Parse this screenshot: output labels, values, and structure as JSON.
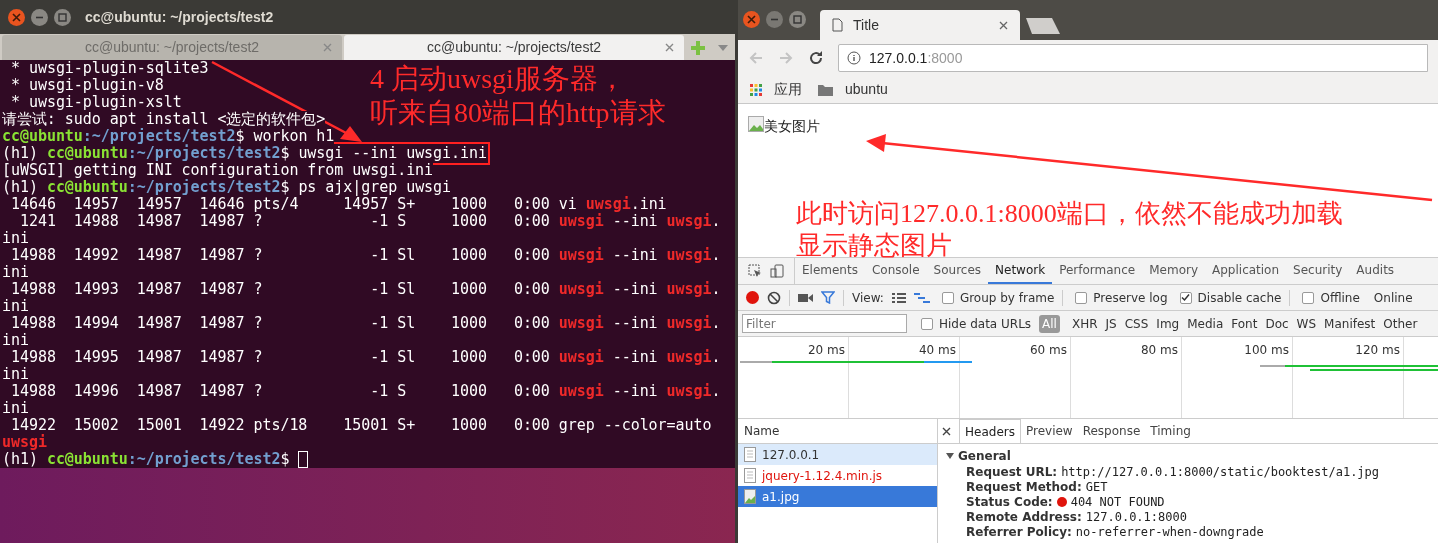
{
  "terminal": {
    "title": "cc@ubuntu: ~/projects/test2",
    "tabs": [
      {
        "label": "cc@ubuntu: ~/projects/test2",
        "selected": false
      },
      {
        "label": "cc@ubuntu: ~/projects/test2",
        "selected": true
      }
    ],
    "lines": [
      {
        "segments": [
          {
            "kind": "plain",
            "text": " * uwsgi-plugin-sqlite3"
          }
        ]
      },
      {
        "segments": [
          {
            "kind": "plain",
            "text": " * uwsgi-plugin-v8"
          }
        ]
      },
      {
        "segments": [
          {
            "kind": "plain",
            "text": " * uwsgi-plugin-xslt"
          }
        ]
      },
      {
        "segments": [
          {
            "kind": "plain",
            "text": "请尝试: sudo apt install <选定的软件包>"
          }
        ]
      },
      {
        "segments": [
          {
            "kind": "user",
            "text": "cc@ubuntu"
          },
          {
            "kind": "path",
            "text": ":~/projects/test2"
          },
          {
            "kind": "plain",
            "text": "$ workon h1"
          }
        ]
      },
      {
        "segments": [
          {
            "kind": "plain",
            "text": "(h1) "
          },
          {
            "kind": "user",
            "text": "cc@ubuntu"
          },
          {
            "kind": "path",
            "text": ":~/projects/test2"
          },
          {
            "kind": "plain",
            "text": "$ "
          },
          {
            "kind": "boxed",
            "text": "uwsgi --ini uwsgi.ini"
          }
        ]
      },
      {
        "segments": [
          {
            "kind": "plain",
            "text": "[uWSGI] getting INI configuration from uwsgi.ini"
          }
        ]
      },
      {
        "segments": [
          {
            "kind": "plain",
            "text": "(h1) "
          },
          {
            "kind": "user",
            "text": "cc@ubuntu"
          },
          {
            "kind": "path",
            "text": ":~/projects/test2"
          },
          {
            "kind": "plain",
            "text": "$ ps ajx|grep uwsgi"
          }
        ]
      },
      {
        "segments": [
          {
            "kind": "plain",
            "text": " 14646  14957  14957  14646 pts/4     14957 S+    1000   0:00 vi "
          },
          {
            "kind": "match",
            "text": "uwsgi"
          },
          {
            "kind": "plain",
            "text": ".ini"
          }
        ]
      },
      {
        "segments": [
          {
            "kind": "plain",
            "text": "  1241  14988  14987  14987 ?            -1 S     1000   0:00 "
          },
          {
            "kind": "match",
            "text": "uwsgi"
          },
          {
            "kind": "plain",
            "text": " --ini "
          },
          {
            "kind": "match",
            "text": "uwsgi"
          },
          {
            "kind": "plain",
            "text": "."
          }
        ]
      },
      {
        "segments": [
          {
            "kind": "plain",
            "text": "ini"
          }
        ]
      },
      {
        "segments": [
          {
            "kind": "plain",
            "text": " 14988  14992  14987  14987 ?            -1 Sl    1000   0:00 "
          },
          {
            "kind": "match",
            "text": "uwsgi"
          },
          {
            "kind": "plain",
            "text": " --ini "
          },
          {
            "kind": "match",
            "text": "uwsgi"
          },
          {
            "kind": "plain",
            "text": "."
          }
        ]
      },
      {
        "segments": [
          {
            "kind": "plain",
            "text": "ini"
          }
        ]
      },
      {
        "segments": [
          {
            "kind": "plain",
            "text": " 14988  14993  14987  14987 ?            -1 Sl    1000   0:00 "
          },
          {
            "kind": "match",
            "text": "uwsgi"
          },
          {
            "kind": "plain",
            "text": " --ini "
          },
          {
            "kind": "match",
            "text": "uwsgi"
          },
          {
            "kind": "plain",
            "text": "."
          }
        ]
      },
      {
        "segments": [
          {
            "kind": "plain",
            "text": "ini"
          }
        ]
      },
      {
        "segments": [
          {
            "kind": "plain",
            "text": " 14988  14994  14987  14987 ?            -1 Sl    1000   0:00 "
          },
          {
            "kind": "match",
            "text": "uwsgi"
          },
          {
            "kind": "plain",
            "text": " --ini "
          },
          {
            "kind": "match",
            "text": "uwsgi"
          },
          {
            "kind": "plain",
            "text": "."
          }
        ]
      },
      {
        "segments": [
          {
            "kind": "plain",
            "text": "ini"
          }
        ]
      },
      {
        "segments": [
          {
            "kind": "plain",
            "text": " 14988  14995  14987  14987 ?            -1 Sl    1000   0:00 "
          },
          {
            "kind": "match",
            "text": "uwsgi"
          },
          {
            "kind": "plain",
            "text": " --ini "
          },
          {
            "kind": "match",
            "text": "uwsgi"
          },
          {
            "kind": "plain",
            "text": "."
          }
        ]
      },
      {
        "segments": [
          {
            "kind": "plain",
            "text": "ini"
          }
        ]
      },
      {
        "segments": [
          {
            "kind": "plain",
            "text": " 14988  14996  14987  14987 ?            -1 S     1000   0:00 "
          },
          {
            "kind": "match",
            "text": "uwsgi"
          },
          {
            "kind": "plain",
            "text": " --ini "
          },
          {
            "kind": "match",
            "text": "uwsgi"
          },
          {
            "kind": "plain",
            "text": "."
          }
        ]
      },
      {
        "segments": [
          {
            "kind": "plain",
            "text": "ini"
          }
        ]
      },
      {
        "segments": [
          {
            "kind": "plain",
            "text": " 14922  15002  15001  14922 pts/18    15001 S+    1000   0:00 grep --color=auto"
          }
        ]
      },
      {
        "segments": [
          {
            "kind": "match",
            "text": "uwsgi"
          }
        ]
      },
      {
        "segments": [
          {
            "kind": "plain",
            "text": "(h1) "
          },
          {
            "kind": "user",
            "text": "cc@ubuntu"
          },
          {
            "kind": "path",
            "text": ":~/projects/test2"
          },
          {
            "kind": "plain",
            "text": "$ "
          }
        ],
        "cursor": true
      }
    ]
  },
  "browser": {
    "tab_title": "Title",
    "url_host": "127.0.0.1",
    "url_port": ":8000",
    "bookmarks": [
      {
        "kind": "apps",
        "label": "应用"
      },
      {
        "kind": "folder",
        "label": "ubuntu"
      }
    ],
    "page": {
      "image_alt": "美女图片"
    },
    "devtools": {
      "tabs": [
        {
          "label": "Elements",
          "selected": false
        },
        {
          "label": "Console",
          "selected": false
        },
        {
          "label": "Sources",
          "selected": false
        },
        {
          "label": "Network",
          "selected": true
        },
        {
          "label": "Performance",
          "selected": false
        },
        {
          "label": "Memory",
          "selected": false
        },
        {
          "label": "Application",
          "selected": false
        },
        {
          "label": "Security",
          "selected": false
        },
        {
          "label": "Audits",
          "selected": false
        }
      ],
      "recording": true,
      "view_label": "View:",
      "options": [
        {
          "label": "Group by frame",
          "checked": false
        },
        {
          "label": "Preserve log",
          "checked": false
        },
        {
          "label": "Disable cache",
          "checked": true
        },
        {
          "label": "Offline",
          "checked": false
        }
      ],
      "throttle": "Online",
      "filter": {
        "placeholder": "Filter"
      },
      "hide_data_urls": {
        "label": "Hide data URLs",
        "checked": false
      },
      "types": [
        {
          "label": "All",
          "selected": true
        },
        {
          "label": "XHR",
          "selected": false
        },
        {
          "label": "JS",
          "selected": false
        },
        {
          "label": "CSS",
          "selected": false
        },
        {
          "label": "Img",
          "selected": false
        },
        {
          "label": "Media",
          "selected": false
        },
        {
          "label": "Font",
          "selected": false
        },
        {
          "label": "Doc",
          "selected": false
        },
        {
          "label": "WS",
          "selected": false
        },
        {
          "label": "Manifest",
          "selected": false
        },
        {
          "label": "Other",
          "selected": false
        }
      ],
      "timeline_ticks": [
        "20 ms",
        "40 ms",
        "60 ms",
        "80 ms",
        "100 ms",
        "120 ms"
      ],
      "list_header": "Name",
      "requests": [
        {
          "name": "127.0.0.1",
          "kind": "document",
          "failed": false,
          "hovered": true,
          "selected": false
        },
        {
          "name": "jquery-1.12.4.min.js",
          "kind": "document",
          "failed": true,
          "hovered": false,
          "selected": false
        },
        {
          "name": "a1.jpg",
          "kind": "image",
          "failed": false,
          "hovered": false,
          "selected": true
        }
      ],
      "detail_tabs": [
        {
          "label": "Headers",
          "selected": true
        },
        {
          "label": "Preview",
          "selected": false
        },
        {
          "label": "Response",
          "selected": false
        },
        {
          "label": "Timing",
          "selected": false
        }
      ],
      "section": {
        "title": "General",
        "expanded": true
      },
      "fields": [
        {
          "label": "Request URL:",
          "value": "http://127.0.0.1:8000/static/booktest/a1.jpg"
        },
        {
          "label": "Request Method:",
          "value": "GET"
        },
        {
          "label": "Status Code:",
          "value": "404 NOT FOUND",
          "color": "#e0140c"
        },
        {
          "label": "Remote Address:",
          "value": "127.0.0.1:8000"
        },
        {
          "label": "Referrer Policy:",
          "value": "no-referrer-when-downgrade"
        }
      ]
    }
  },
  "annotations": [
    {
      "lines": [
        "4 启动uwsgi服务器，",
        "听来自80端口的http请求"
      ]
    },
    {
      "lines": [
        "此时访问127.0.0.1:8000端口，依然不能成功加载",
        "显示静态图片"
      ]
    }
  ]
}
